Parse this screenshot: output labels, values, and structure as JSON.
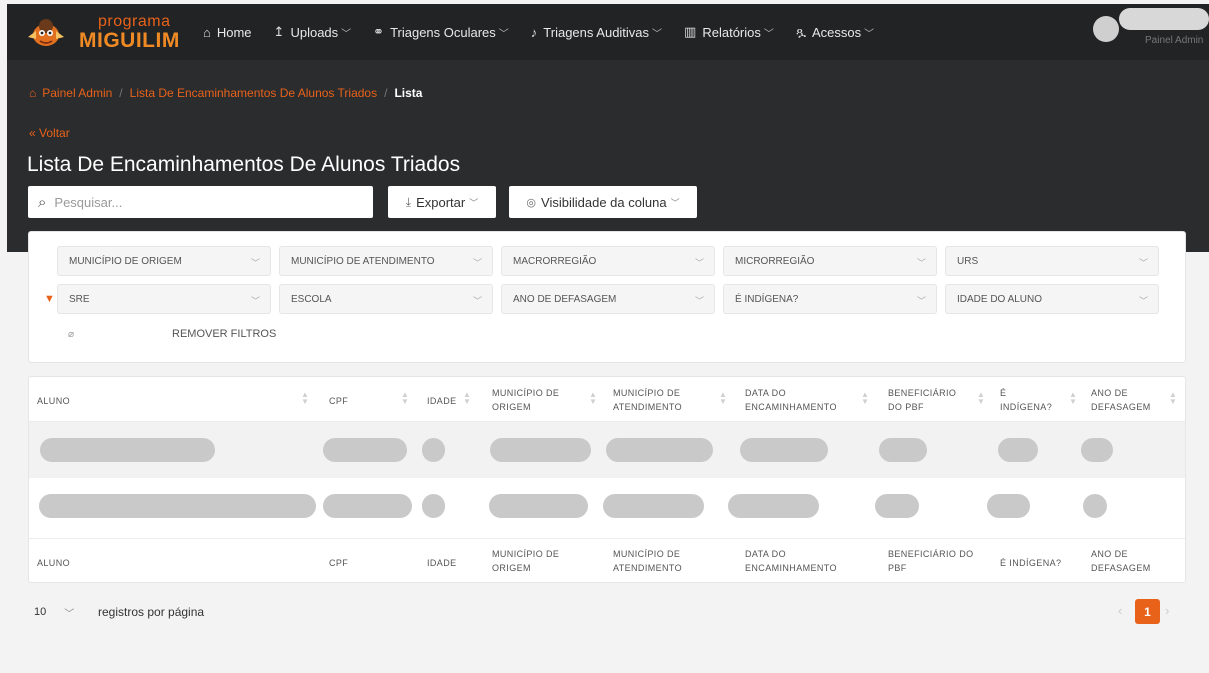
{
  "brand": {
    "line1": "programa",
    "line2": "MIGUILIM"
  },
  "nav": {
    "items": [
      {
        "label": "Home",
        "icon": "home-icon",
        "dropdown": false
      },
      {
        "label": "Uploads",
        "icon": "upload-icon",
        "dropdown": true
      },
      {
        "label": "Triagens Oculares",
        "icon": "glasses-icon",
        "dropdown": true
      },
      {
        "label": "Triagens Auditivas",
        "icon": "hearing-icon",
        "dropdown": true
      },
      {
        "label": "Relatórios",
        "icon": "chart-icon",
        "dropdown": true
      },
      {
        "label": "Acessos",
        "icon": "users-icon",
        "dropdown": true
      }
    ]
  },
  "user": {
    "role": "Painel Admin"
  },
  "breadcrumb": {
    "items": [
      "Painel Admin",
      "Lista De Encaminhamentos De Alunos Triados"
    ],
    "current": "Lista"
  },
  "back_label": "Voltar",
  "page_title": "Lista De Encaminhamentos De Alunos Triados",
  "search": {
    "placeholder": "Pesquisar...",
    "value": ""
  },
  "export_label": "Exportar",
  "visibility_label": "Visibilidade da coluna",
  "filters": {
    "row1": [
      "MUNICÍPIO DE ORIGEM",
      "MUNICÍPIO DE ATENDIMENTO",
      "MACRORREGIÃO",
      "MICRORREGIÃO",
      "URS"
    ],
    "row2": [
      "SRE",
      "ESCOLA",
      "ANO DE DEFASAGEM",
      "É INDÍGENA?",
      "IDADE DO ALUNO"
    ],
    "remove_label": "REMOVER FILTROS"
  },
  "table": {
    "header": [
      "ALUNO",
      "CPF",
      "IDADE",
      "MUNICÍPIO DE ORIGEM",
      "MUNICÍPIO DE ATENDIMENTO",
      "DATA DO ENCAMINHAMENTO",
      "BENEFICIÁRIO DO PBF",
      "É INDÍGENA?",
      "ANO DE DEFASAGEM"
    ],
    "footer": [
      "ALUNO",
      "CPF",
      "IDADE",
      "MUNICÍPIO DE ORIGEM",
      "MUNICÍPIO DE ATENDIMENTO",
      "DATA DO ENCAMINHAMENTO",
      "BENEFICIÁRIO DO PBF",
      "É INDÍGENA?",
      "ANO DE DEFASAGEM"
    ]
  },
  "pagination": {
    "per_page": "10",
    "per_page_label": "registros por página",
    "current_page": "1"
  },
  "colors": {
    "accent": "#e8621a",
    "dark": "#2b2c2d",
    "topbar": "#222324"
  }
}
